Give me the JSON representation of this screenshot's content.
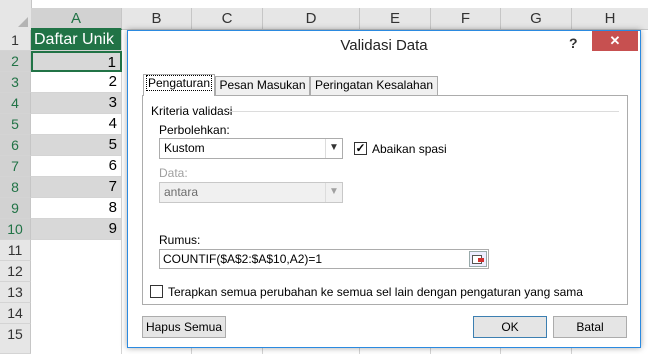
{
  "sheet": {
    "columns": [
      "A",
      "B",
      "C",
      "D",
      "E",
      "F",
      "G",
      "H"
    ],
    "rows": [
      "1",
      "2",
      "3",
      "4",
      "5",
      "6",
      "7",
      "8",
      "9",
      "10",
      "11",
      "12",
      "13",
      "14",
      "15"
    ],
    "header_cell": "Daftar Unik",
    "values": [
      "1",
      "2",
      "3",
      "4",
      "5",
      "6",
      "7",
      "8",
      "9"
    ]
  },
  "dialog": {
    "title": "Validasi Data",
    "help": "?",
    "close": "✕",
    "tabs": [
      "Pengaturan",
      "Pesan Masukan",
      "Peringatan Kesalahan"
    ],
    "group_label": "Kriteria validasi",
    "allow_label": "Perbolehkan:",
    "allow_value": "Kustom",
    "ignore_blank_label": "Abaikan spasi",
    "ignore_blank_checked": true,
    "data_label": "Data:",
    "data_value": "antara",
    "formula_label": "Rumus:",
    "formula_value": "COUNTIF($A$2:$A$10,A2)=1",
    "apply_all_label": "Terapkan semua perubahan ke semua sel lain dengan pengaturan yang sama",
    "apply_all_checked": false,
    "clear_all_button": "Hapus Semua",
    "ok_button": "OK",
    "cancel_button": "Batal",
    "icons": {
      "dropdown": "chevron-down-icon",
      "check": "checkmark-icon",
      "collapse": "range-select-icon"
    }
  },
  "colors": {
    "excel_green": "#217346",
    "close_red": "#c75050",
    "dialog_border": "#2b8ae0"
  }
}
